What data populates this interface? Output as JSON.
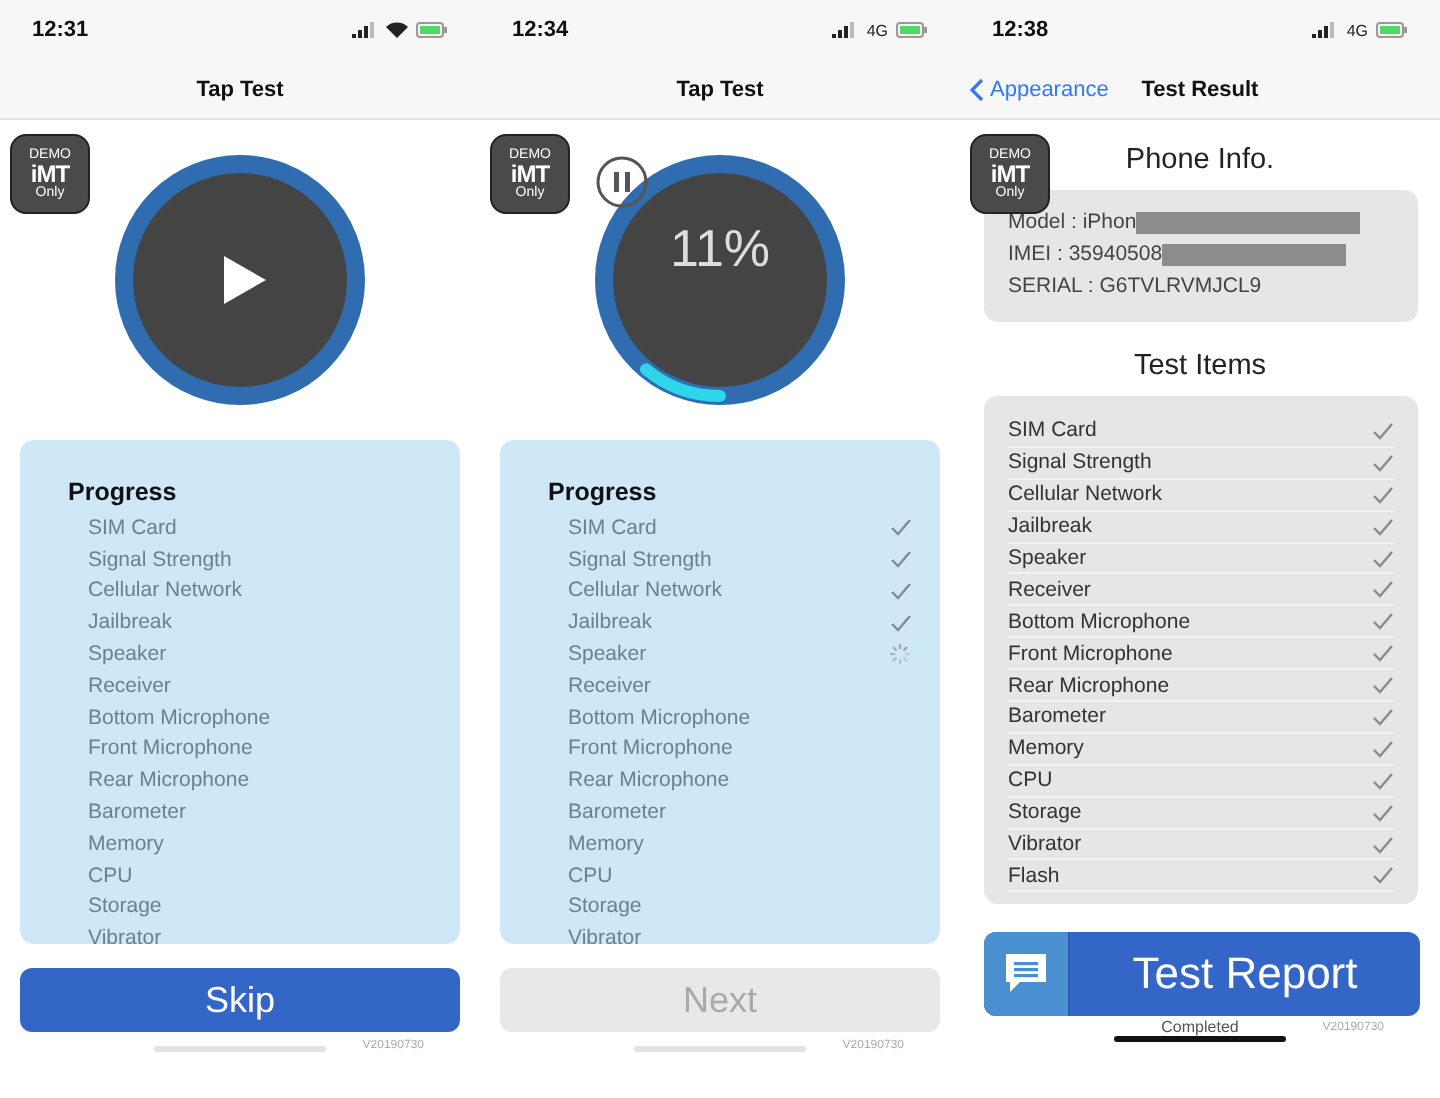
{
  "screens": [
    {
      "kind": "tap_test",
      "status_bar": {
        "time": "12:31",
        "wifi": true
      },
      "nav": {
        "title": "Tap Test"
      },
      "logo": {
        "top": "DEMO",
        "brand": "iMT",
        "bottom": "Only"
      },
      "dial": {
        "kind": "play"
      },
      "progress": {
        "title": "Progress",
        "items": [
          {
            "label": "SIM Card"
          },
          {
            "label": "Signal Strength"
          },
          {
            "label": "Cellular Network"
          },
          {
            "label": "Jailbreak"
          },
          {
            "label": "Speaker"
          },
          {
            "label": "Receiver"
          },
          {
            "label": "Bottom Microphone"
          },
          {
            "label": "Front Microphone"
          },
          {
            "label": "Rear Microphone"
          },
          {
            "label": "Barometer"
          },
          {
            "label": "Memory"
          },
          {
            "label": "CPU"
          },
          {
            "label": "Storage"
          },
          {
            "label": "Vibrator"
          }
        ]
      },
      "button": {
        "label": "Skip",
        "disabled": false
      },
      "version": "V20190730"
    },
    {
      "kind": "tap_test",
      "status_bar": {
        "time": "12:34",
        "carrier": "4G"
      },
      "nav": {
        "title": "Tap Test"
      },
      "logo": {
        "top": "DEMO",
        "brand": "iMT",
        "bottom": "Only"
      },
      "dial": {
        "kind": "running",
        "percent": "11%"
      },
      "progress": {
        "title": "Progress",
        "items": [
          {
            "label": "SIM Card",
            "checked": true,
            "loading": false
          },
          {
            "label": "Signal Strength",
            "checked": true,
            "loading": false
          },
          {
            "label": "Cellular Network",
            "checked": true,
            "loading": false
          },
          {
            "label": "Jailbreak",
            "checked": true,
            "loading": false
          },
          {
            "label": "Speaker",
            "checked": false,
            "loading": true
          },
          {
            "label": "Receiver",
            "checked": false,
            "loading": false
          },
          {
            "label": "Bottom Microphone",
            "checked": false,
            "loading": false
          },
          {
            "label": "Front Microphone",
            "checked": false,
            "loading": false
          },
          {
            "label": "Rear Microphone",
            "checked": false,
            "loading": false
          },
          {
            "label": "Barometer",
            "checked": false,
            "loading": false
          },
          {
            "label": "Memory",
            "checked": false,
            "loading": false
          },
          {
            "label": "CPU",
            "checked": false,
            "loading": false
          },
          {
            "label": "Storage",
            "checked": false,
            "loading": false
          },
          {
            "label": "Vibrator",
            "checked": false,
            "loading": false
          }
        ]
      },
      "button": {
        "label": "Next",
        "disabled": true
      },
      "version": "V20190730"
    },
    {
      "kind": "result",
      "status_bar": {
        "time": "12:38",
        "carrier": "4G"
      },
      "nav": {
        "back": "Appearance",
        "title": "Test Result"
      },
      "logo": {
        "top": "DEMO",
        "brand": "iMT",
        "bottom": "Only"
      },
      "phone_info": {
        "title": "Phone Info.",
        "lines": [
          {
            "text": "Model : iPhon",
            "redacted": true
          },
          {
            "text": "IMEI : 35940508",
            "redacted": true
          },
          {
            "text": "SERIAL : G6TVLRVMJCL9",
            "redacted": false
          }
        ]
      },
      "test_items": {
        "title": "Test Items",
        "items": [
          {
            "label": "SIM Card",
            "checked": true
          },
          {
            "label": "Signal Strength",
            "checked": true
          },
          {
            "label": "Cellular Network",
            "checked": true
          },
          {
            "label": "Jailbreak",
            "checked": true
          },
          {
            "label": "Speaker",
            "checked": true
          },
          {
            "label": "Receiver",
            "checked": true
          },
          {
            "label": "Bottom Microphone",
            "checked": true
          },
          {
            "label": "Front Microphone",
            "checked": true
          },
          {
            "label": "Rear Microphone",
            "checked": true
          },
          {
            "label": "Barometer",
            "checked": true
          },
          {
            "label": "Memory",
            "checked": true
          },
          {
            "label": "CPU",
            "checked": true
          },
          {
            "label": "Storage",
            "checked": true
          },
          {
            "label": "Vibrator",
            "checked": true
          },
          {
            "label": "Flash",
            "checked": true
          }
        ]
      },
      "button": {
        "label": "Test Report"
      },
      "footer": "Completed",
      "version": "V20190730"
    }
  ]
}
